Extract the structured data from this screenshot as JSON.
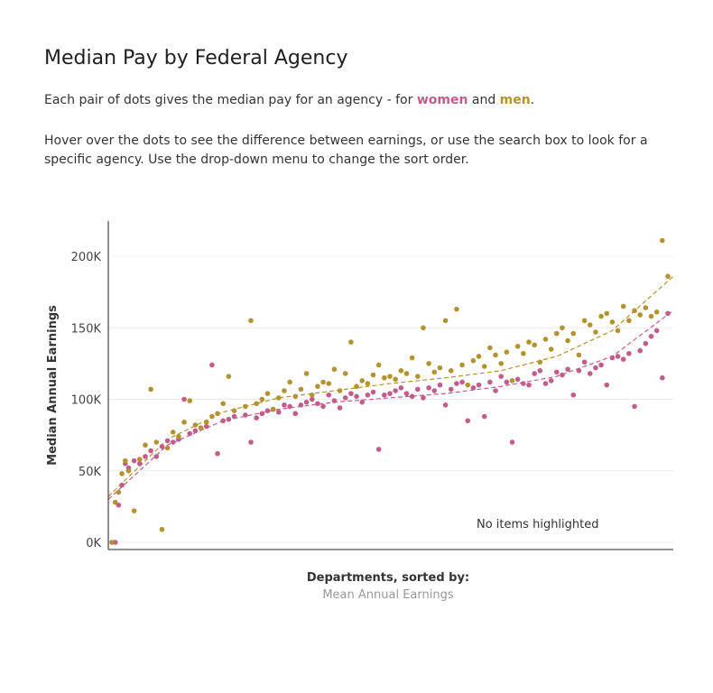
{
  "title": "Median Pay by Federal Agency",
  "intro": {
    "prefix": "Each pair of dots gives the median pay for an agency - for ",
    "women": "women",
    "middle": " and ",
    "men": "men",
    "suffix": "."
  },
  "hint": "Hover over the dots to see the difference between earnings, or use the search box to look for a specific agency. Use the drop-down menu to change the sort order.",
  "sort": {
    "label": "Departments,  sorted by:",
    "value": "Mean Annual Earnings"
  },
  "status": "No items highlighted",
  "colors": {
    "women": "#c25d8b",
    "men": "#b39330",
    "axis": "#222222",
    "grid": "#ececec"
  },
  "chart_data": {
    "type": "scatter",
    "title": "",
    "xlabel": "",
    "ylabel": "Median Annual Earnings",
    "ylim": [
      -5000,
      230000
    ],
    "xlim": [
      0,
      100
    ],
    "yticks": [
      0,
      50000,
      100000,
      150000,
      200000
    ],
    "ytick_labels": [
      "0K",
      "50K",
      "100K",
      "150K",
      "200K"
    ],
    "grid": true,
    "series": [
      {
        "name": "women",
        "color": "#c25d8b",
        "x": [
          0,
          0.6,
          1.2,
          1.8,
          2.4,
          3,
          4,
          5,
          6,
          7,
          8,
          9,
          10,
          11,
          12,
          13,
          14,
          15,
          16,
          17,
          18,
          19,
          20,
          21,
          22,
          24,
          25,
          26,
          27,
          28,
          29,
          30,
          31,
          32,
          33,
          34,
          35,
          36,
          37,
          38,
          39,
          40,
          41,
          42,
          43,
          44,
          45,
          46,
          47,
          48,
          49,
          50,
          51,
          52,
          53,
          54,
          55,
          56,
          57,
          58,
          59,
          60,
          61,
          62,
          63,
          64,
          65,
          66,
          67,
          68,
          69,
          70,
          71,
          72,
          73,
          74,
          75,
          76,
          77,
          78,
          79,
          80,
          81,
          82,
          83,
          84,
          85,
          86,
          87,
          88,
          89,
          90,
          91,
          92,
          93,
          94,
          95,
          96,
          97,
          98,
          99,
          100
        ],
        "y": [
          0,
          0,
          26000,
          40000,
          55000,
          52000,
          57000,
          55000,
          60000,
          64000,
          60000,
          67000,
          71000,
          70000,
          72000,
          100000,
          76000,
          78000,
          80000,
          81000,
          124000,
          62000,
          85000,
          86000,
          88000,
          89000,
          70000,
          87000,
          90000,
          92000,
          93000,
          91000,
          96000,
          95000,
          90000,
          96000,
          98000,
          100000,
          97000,
          95000,
          103000,
          99000,
          94000,
          101000,
          104000,
          102000,
          98000,
          103000,
          105000,
          65000,
          103000,
          104000,
          106000,
          108000,
          104000,
          102000,
          107000,
          101000,
          108000,
          106000,
          110000,
          96000,
          107000,
          111000,
          112000,
          85000,
          108000,
          110000,
          88000,
          112000,
          106000,
          116000,
          112000,
          70000,
          114000,
          111000,
          110000,
          118000,
          120000,
          111000,
          113000,
          119000,
          117000,
          121000,
          103000,
          120000,
          126000,
          118000,
          122000,
          124000,
          110000,
          129000,
          130000,
          128000,
          132000,
          95000,
          134000,
          139000,
          144000,
          148000,
          115000,
          160000
        ]
      },
      {
        "name": "men",
        "color": "#b39330",
        "x": [
          0,
          0.6,
          1.2,
          1.8,
          2.4,
          3,
          4,
          5,
          6,
          7,
          8,
          9,
          10,
          11,
          12,
          13,
          14,
          15,
          16,
          17,
          18,
          19,
          20,
          21,
          22,
          24,
          25,
          26,
          27,
          28,
          29,
          30,
          31,
          32,
          33,
          34,
          35,
          36,
          37,
          38,
          39,
          40,
          41,
          42,
          43,
          44,
          45,
          46,
          47,
          48,
          49,
          50,
          51,
          52,
          53,
          54,
          55,
          56,
          57,
          58,
          59,
          60,
          61,
          62,
          63,
          64,
          65,
          66,
          67,
          68,
          69,
          70,
          71,
          72,
          73,
          74,
          75,
          76,
          77,
          78,
          79,
          80,
          81,
          82,
          83,
          84,
          85,
          86,
          87,
          88,
          89,
          90,
          91,
          92,
          93,
          94,
          95,
          96,
          97,
          98,
          99,
          100
        ],
        "y": [
          0,
          28000,
          35000,
          48000,
          57000,
          50000,
          22000,
          58000,
          68000,
          107000,
          70000,
          9000,
          66000,
          77000,
          74000,
          84000,
          99000,
          82000,
          80000,
          84000,
          88000,
          90000,
          97000,
          116000,
          92000,
          95000,
          155000,
          97000,
          100000,
          104000,
          93000,
          101000,
          106000,
          112000,
          102000,
          107000,
          118000,
          103000,
          109000,
          112000,
          111000,
          121000,
          106000,
          118000,
          140000,
          109000,
          113000,
          111000,
          117000,
          124000,
          115000,
          116000,
          114000,
          120000,
          118000,
          129000,
          116000,
          150000,
          125000,
          119000,
          122000,
          155000,
          120000,
          163000,
          124000,
          110000,
          127000,
          130000,
          123000,
          136000,
          131000,
          125000,
          133000,
          113000,
          137000,
          132000,
          140000,
          138000,
          126000,
          142000,
          135000,
          146000,
          150000,
          141000,
          146000,
          131000,
          155000,
          152000,
          147000,
          158000,
          160000,
          154000,
          148000,
          165000,
          155000,
          162000,
          159000,
          164000,
          158000,
          161000,
          211000,
          186000
        ]
      }
    ],
    "trendlines": [
      {
        "series": "women",
        "x": [
          0,
          10,
          20,
          30,
          40,
          50,
          60,
          70,
          80,
          90,
          100
        ],
        "y": [
          30000,
          68000,
          85000,
          93000,
          98000,
          101000,
          104000,
          109000,
          116000,
          130000,
          162000
        ]
      },
      {
        "series": "men",
        "x": [
          0,
          10,
          20,
          30,
          40,
          50,
          60,
          70,
          80,
          90,
          100
        ],
        "y": [
          32000,
          72000,
          91000,
          101000,
          106000,
          111000,
          115000,
          120000,
          130000,
          148000,
          186000
        ]
      }
    ]
  }
}
